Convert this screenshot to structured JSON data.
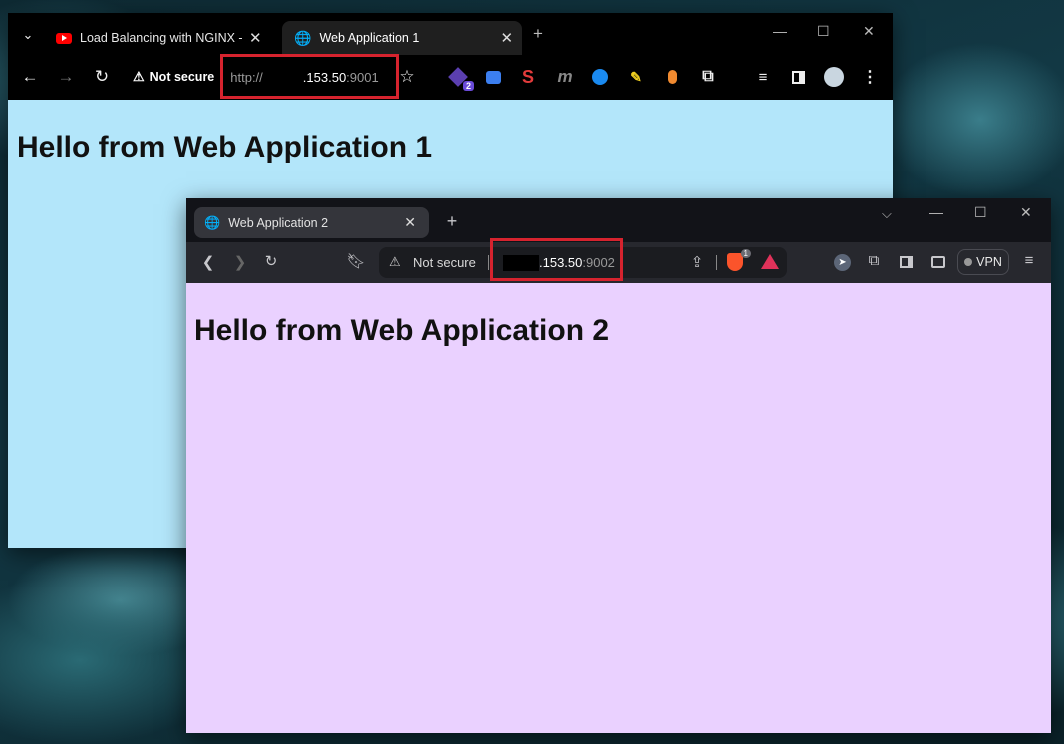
{
  "window1": {
    "tabs": [
      {
        "title": "Load Balancing with NGINX - Yo",
        "icon": "youtube-icon"
      },
      {
        "title": "Web Application 1",
        "icon": "globe-icon"
      }
    ],
    "new_tab": "+",
    "security_label": "Not secure",
    "url": {
      "scheme": "http://",
      "host_suffix": ".153.50",
      "port": ":9001"
    },
    "extension_badge": "2",
    "heading": "Hello from Web Application 1",
    "colors": {
      "page_bg": "#b3e6fa",
      "chrome": "#000000"
    }
  },
  "window2": {
    "tabs": [
      {
        "title": "Web Application 2",
        "icon": "globe-icon"
      }
    ],
    "new_tab": "+",
    "security_label": "Not secure",
    "url": {
      "host_suffix": ".153.50",
      "port": ":9002"
    },
    "shields_badge": "1",
    "vpn_label": "VPN",
    "heading": "Hello from Web Application 2",
    "colors": {
      "page_bg": "#ead1ff",
      "chrome": "#27282e"
    }
  },
  "highlight_color": "#d6232e"
}
